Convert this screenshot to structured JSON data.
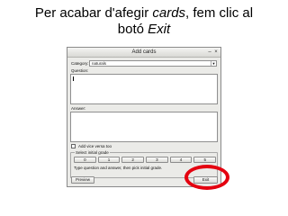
{
  "caption": {
    "line1_before": "Per acabar d'afegir ",
    "line1_emph": "cards",
    "line1_after": ", fem clic al",
    "line2_before": "botó ",
    "line2_emph": "Exit"
  },
  "window": {
    "title": "Add cards",
    "controls": [
      "–",
      "×"
    ]
  },
  "form": {
    "category_label": "Category:",
    "category_value": "naturals",
    "question_label": "Question:",
    "question_value": "",
    "answer_label": "Answer:",
    "answer_value": "",
    "vice_versa_label": "Add vice versa too"
  },
  "grades_group": {
    "title": "Select initial grade",
    "grades": [
      "0",
      "1",
      "2",
      "3",
      "4",
      "5"
    ],
    "hint": "Type question and answer, then pick initial grade."
  },
  "buttons": {
    "preview": "Preview",
    "exit": "Exit"
  },
  "colors": {
    "highlight_ring": "#e4000f"
  },
  "icons": {
    "combo_arrow": "chevron-down-icon",
    "checkbox": "checkbox-icon"
  }
}
